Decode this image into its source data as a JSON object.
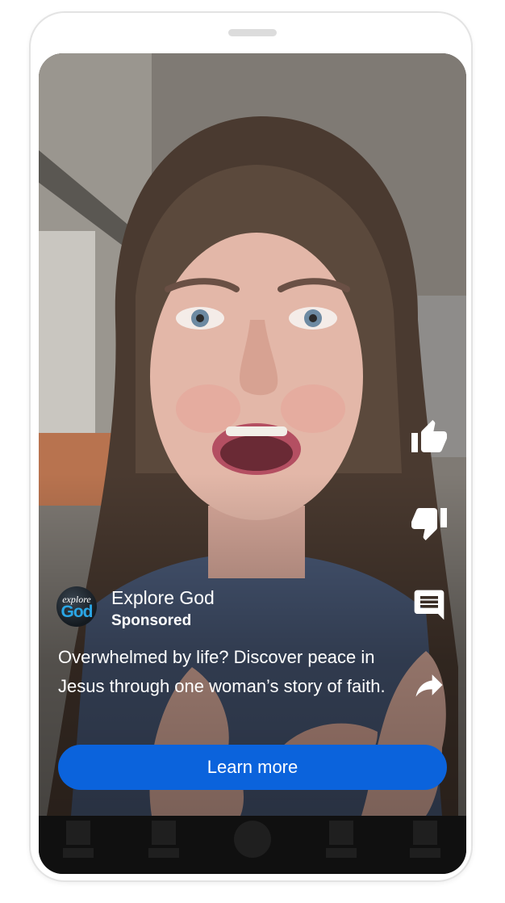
{
  "ad": {
    "channel_name": "Explore God",
    "sponsored_label": "Sponsored",
    "description": "Overwhelmed by life? Discover peace in Jesus through one woman’s story of faith.",
    "cta_label": "Learn more",
    "avatar_text_top": "explore",
    "avatar_text_bottom": "God"
  },
  "actions": [
    {
      "name": "like",
      "icon": "thumbs-up-icon"
    },
    {
      "name": "dislike",
      "icon": "thumbs-down-icon"
    },
    {
      "name": "comments",
      "icon": "comment-icon"
    },
    {
      "name": "share",
      "icon": "share-icon"
    }
  ],
  "nav": {
    "items": [
      "placeholder",
      "placeholder",
      "home-circle",
      "placeholder",
      "placeholder"
    ]
  },
  "colors": {
    "cta": "#0b63dc",
    "navbar": "#101010",
    "nav_placeholder": "#1f1f1f",
    "text": "#ffffff"
  }
}
